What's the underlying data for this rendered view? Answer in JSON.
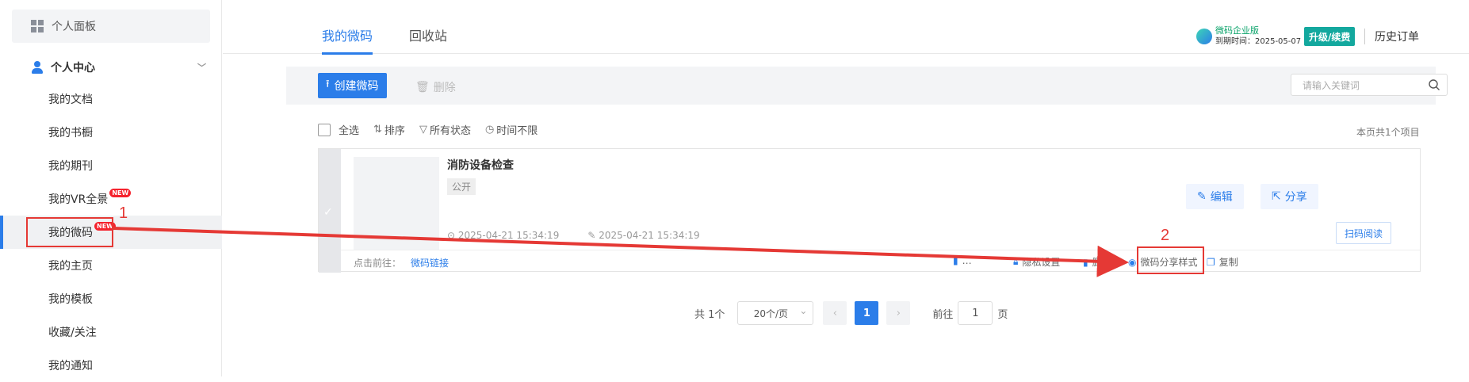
{
  "sidebar": {
    "panel": "个人面板",
    "center": "个人中心",
    "items": [
      {
        "label": "我的文档",
        "badge": ""
      },
      {
        "label": "我的书橱",
        "badge": ""
      },
      {
        "label": "我的期刊",
        "badge": ""
      },
      {
        "label": "我的VR全景",
        "badge": "NEW"
      },
      {
        "label": "我的微码",
        "badge": "NEW",
        "active": true
      },
      {
        "label": "我的主页",
        "badge": ""
      },
      {
        "label": "我的模板",
        "badge": ""
      },
      {
        "label": "收藏/关注",
        "badge": ""
      },
      {
        "label": "我的通知",
        "badge": ""
      }
    ]
  },
  "tabs": [
    "我的微码",
    "回收站"
  ],
  "enterprise": {
    "name": "微码企业版",
    "expire": "到期时间：2025-05-07",
    "upgrade": "升级/续费",
    "history": "历史订单"
  },
  "toolbar": {
    "create": "创建微码",
    "delete": "删除",
    "search_placeholder": "请输入关键词"
  },
  "filters": {
    "select_all": "全选",
    "sort": "排序",
    "status": "所有状态",
    "time": "时间不限",
    "count": "本页共1个项目"
  },
  "card": {
    "title": "消防设备检查",
    "tag": "公开",
    "created": "2025-04-21 15:34:19",
    "updated": "2025-04-21 15:34:19",
    "edit": "编辑",
    "share": "分享",
    "scan": "扫码阅读",
    "goto_label": "点击前往：",
    "goto_link": "微码链接",
    "actions": {
      "hidden_partial": "…",
      "privacy": "隐私设置",
      "delete": "删除",
      "share_style": "微码分享样式",
      "copy": "复制"
    }
  },
  "pager": {
    "total": "共 1个",
    "page_size": "20个/页",
    "current": "1",
    "goto": "前往",
    "goto_value": "1",
    "page_unit": "页"
  },
  "annotations": {
    "one": "1",
    "two": "2",
    "color": "#e53935"
  }
}
